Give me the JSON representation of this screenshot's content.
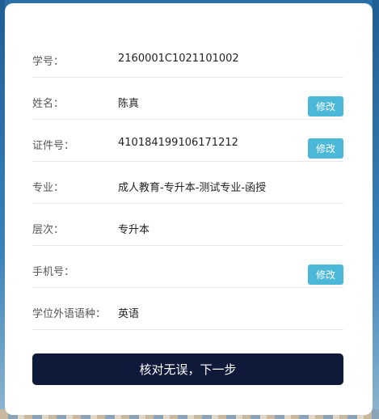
{
  "form": {
    "rows": [
      {
        "label": "学号：",
        "value": "2160001C1021101002",
        "edit": ""
      },
      {
        "label": "姓名：",
        "value": "陈真",
        "edit": "修改"
      },
      {
        "label": "证件号：",
        "value": "410184199106171212",
        "edit": "修改"
      },
      {
        "label": "专业：",
        "value": "成人教育-专升本-测试专业-函授",
        "edit": ""
      },
      {
        "label": "层次：",
        "value": "专升本",
        "edit": ""
      },
      {
        "label": "手机号：",
        "value": "",
        "edit": "修改"
      },
      {
        "label": "学位外语语种：",
        "value": "英语",
        "edit": ""
      }
    ],
    "submit_label": "核对无误，下一步"
  },
  "colors": {
    "edit_button": "#4cb8d8",
    "submit_button": "#0f1a3a"
  }
}
